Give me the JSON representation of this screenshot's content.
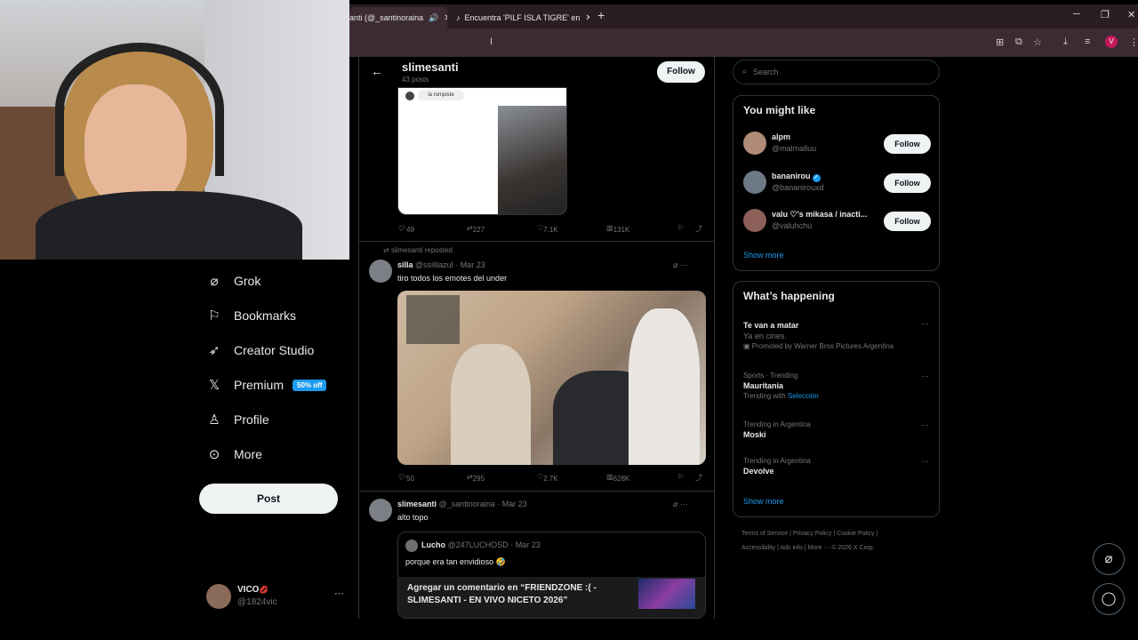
{
  "browser": {
    "tabs": [
      {
        "title": "anti (@_santinoraina",
        "active": true
      },
      {
        "title": "Encuentra 'PILF ISLA TIGRE' en",
        "active": false
      }
    ]
  },
  "profile": {
    "name": "slimesanti",
    "posts": "43 posts",
    "follow_label": "Follow"
  },
  "nav": [
    {
      "icon": "grok-icon",
      "label": "Grok"
    },
    {
      "icon": "bookmark-icon",
      "label": "Bookmarks"
    },
    {
      "icon": "rocket-icon",
      "label": "Creator Studio"
    },
    {
      "icon": "x-logo-icon",
      "label": "Premium",
      "badge": "50% off"
    },
    {
      "icon": "person-icon",
      "label": "Profile"
    },
    {
      "icon": "more-circle-icon",
      "label": "More"
    }
  ],
  "post_button": "Post",
  "account": {
    "name": "VICO",
    "name_emoji": "💋",
    "handle": "@1824vic"
  },
  "post1": {
    "media_caption": "la rompiste",
    "stats": {
      "replies": "49",
      "reposts": "227",
      "likes": "7.1K",
      "views": "131K"
    }
  },
  "post2": {
    "repost_label": "slimesanti reposted",
    "name": "silla",
    "handle": "@ssilliazul",
    "date": "Mar 23",
    "text": "tiro todos los emotes del under",
    "stats": {
      "replies": "50",
      "reposts": "295",
      "likes": "2.7K",
      "views": "628K"
    }
  },
  "post3": {
    "name": "slimesanti",
    "handle": "@_santinoraina",
    "date": "Mar 23",
    "text": "alto topo",
    "quote": {
      "name": "Lucho",
      "handle": "@247LUCHOSD",
      "date": "Mar 23",
      "text": "porque era tan envidioso 🤣",
      "card_text": "Agregar un comentario en “FRIENDZONE :( - SLIMESANTI - EN VIVO NICETO 2026”"
    }
  },
  "search": {
    "placeholder": "Search"
  },
  "you_might_like": {
    "title": "You might like",
    "users": [
      {
        "name": "alpm",
        "handle": "@malmalluu",
        "verified": false,
        "follow": "Follow"
      },
      {
        "name": "bananirou",
        "handle": "@bananirouxd",
        "verified": true,
        "follow": "Follow"
      },
      {
        "name": "valu ♡'s mikasa / inacti...",
        "handle": "@valuhchu",
        "verified": false,
        "follow": "Follow"
      }
    ],
    "show_more": "Show more"
  },
  "whats_happening": {
    "title": "What’s happening",
    "trends": [
      {
        "context": "",
        "title": "Te van a matar",
        "sub": "Ya en cines.",
        "promo": "Promoted by Warner Bros Pictures Argentina"
      },
      {
        "context": "Sports · Trending",
        "title": "Mauritania",
        "sub": "Trending with",
        "link": "Selección"
      },
      {
        "context": "Trending in Argentina",
        "title": "Moski"
      },
      {
        "context": "Trending in Argentina",
        "title": "Devolve"
      }
    ],
    "show_more": "Show more"
  },
  "footer": {
    "line1": "Terms of Service  |  Privacy Policy  |  Cookie Policy  |",
    "line2": "Accessibility  |  Ads info  |  More ···  © 2026 X Corp."
  }
}
